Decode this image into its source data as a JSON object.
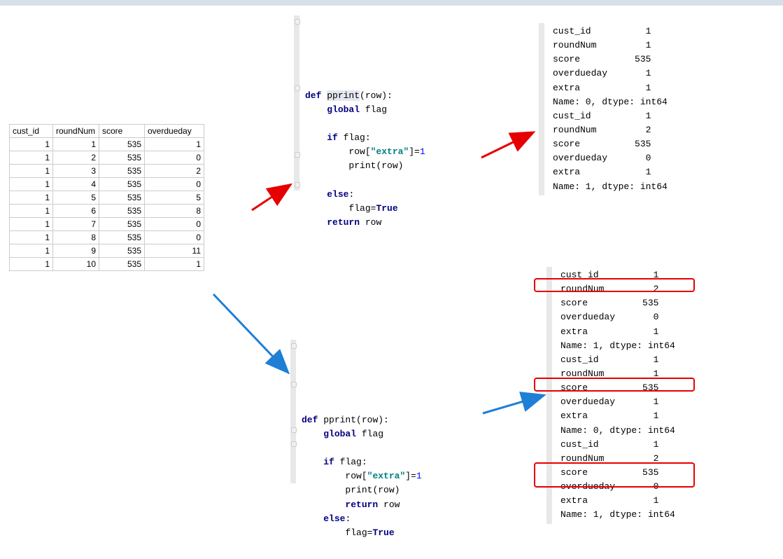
{
  "table": {
    "headers": [
      "cust_id",
      "roundNum",
      "score",
      "overdueday"
    ],
    "rows": [
      [
        1,
        1,
        535,
        1
      ],
      [
        1,
        2,
        535,
        0
      ],
      [
        1,
        3,
        535,
        2
      ],
      [
        1,
        4,
        535,
        0
      ],
      [
        1,
        5,
        535,
        5
      ],
      [
        1,
        6,
        535,
        8
      ],
      [
        1,
        7,
        535,
        0
      ],
      [
        1,
        8,
        535,
        0
      ],
      [
        1,
        9,
        535,
        11
      ],
      [
        1,
        10,
        535,
        1
      ]
    ]
  },
  "code1": {
    "kw_def": "def",
    "fn_name": "pprint",
    "param": "row",
    "kw_global": "global",
    "var_flag": "flag",
    "kw_if": "if",
    "row_ref": "row",
    "key_extra": "\"extra\"",
    "assign_val": "1",
    "print_call": "print",
    "kw_else": "else",
    "flag_assign": "flag=",
    "true_lit": "True",
    "kw_return": "return",
    "ret_val": "row"
  },
  "code2": {
    "kw_def": "def",
    "fn_name": "pprint",
    "param": "row",
    "kw_global": "global",
    "var_flag": "flag",
    "kw_if": "if",
    "row_ref": "row",
    "key_extra": "\"extra\"",
    "assign_val": "1",
    "print_call": "print",
    "kw_return": "return",
    "ret_val": "row",
    "kw_else": "else",
    "flag_assign": "flag=",
    "true_lit": "True"
  },
  "output1": {
    "lines": [
      "cust_id          1",
      "roundNum         1",
      "score          535",
      "overdueday       1",
      "extra            1",
      "Name: 0, dtype: int64",
      "cust_id          1",
      "roundNum         2",
      "score          535",
      "overdueday       0",
      "extra            1",
      "Name: 1, dtype: int64"
    ]
  },
  "output2": {
    "lines": [
      "cust_id          1",
      "roundNum         2",
      "score          535",
      "overdueday       0",
      "extra            1",
      "Name: 1, dtype: int64",
      "cust_id          1",
      "roundNum         1",
      "score          535",
      "overdueday       1",
      "extra            1",
      "Name: 0, dtype: int64",
      "cust_id          1",
      "roundNum         2",
      "score          535",
      "overdueday       0",
      "extra            1",
      "Name: 1, dtype: int64"
    ]
  }
}
